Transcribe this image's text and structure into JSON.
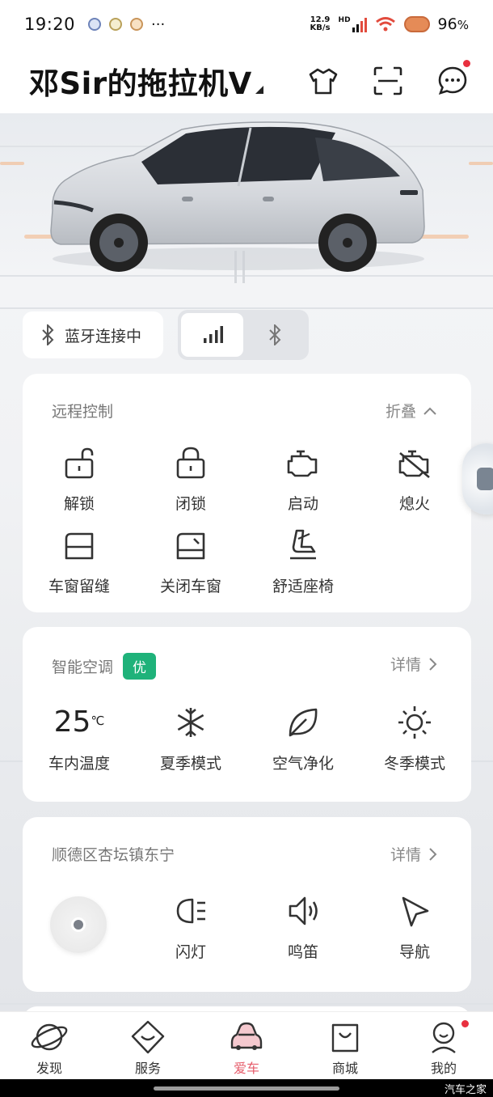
{
  "status_bar": {
    "time": "19:20",
    "dots": "···",
    "net_speed_value": "12.9",
    "net_speed_unit": "KB/s",
    "network": "HD",
    "battery": "96",
    "battery_unit": "%"
  },
  "header": {
    "title": "邓Sir的拖拉机V",
    "icons": [
      "shirt-icon",
      "scan-icon",
      "message-icon"
    ]
  },
  "connection": {
    "bluetooth_label": "蓝牙连接中",
    "modes": [
      "signal",
      "bluetooth"
    ],
    "active_mode": "signal"
  },
  "remote_control": {
    "title": "远程控制",
    "collapse_label": "折叠",
    "items": [
      {
        "label": "解锁",
        "icon": "unlock-icon"
      },
      {
        "label": "闭锁",
        "icon": "lock-icon"
      },
      {
        "label": "启动",
        "icon": "engine-start-icon"
      },
      {
        "label": "熄火",
        "icon": "engine-off-icon"
      },
      {
        "label": "车窗留缝",
        "icon": "window-vent-icon"
      },
      {
        "label": "关闭车窗",
        "icon": "window-close-icon"
      },
      {
        "label": "舒适座椅",
        "icon": "seat-icon"
      }
    ]
  },
  "climate": {
    "title": "智能空调",
    "badge": "优",
    "details_label": "详情",
    "temperature": "25",
    "temp_unit": "℃",
    "items": [
      {
        "label": "车内温度"
      },
      {
        "label": "夏季模式",
        "icon": "snowflake-icon"
      },
      {
        "label": "空气净化",
        "icon": "leaf-icon"
      },
      {
        "label": "冬季模式",
        "icon": "sun-icon"
      }
    ]
  },
  "location": {
    "title": "顺德区杏坛镇东宁",
    "details_label": "详情",
    "items": [
      {
        "label": "闪灯",
        "icon": "headlight-icon"
      },
      {
        "label": "鸣笛",
        "icon": "horn-icon"
      },
      {
        "label": "导航",
        "icon": "navigation-icon"
      }
    ]
  },
  "bottom_nav": {
    "items": [
      {
        "label": "发现",
        "icon": "planet-icon"
      },
      {
        "label": "服务",
        "icon": "service-icon"
      },
      {
        "label": "爱车",
        "icon": "car-icon"
      },
      {
        "label": "商城",
        "icon": "shop-bag-icon"
      },
      {
        "label": "我的",
        "icon": "profile-icon"
      }
    ],
    "active": "爱车"
  },
  "watermark": "汽车之家",
  "colors": {
    "accent_active": "#e65b6a",
    "badge_green": "#1fb27a",
    "notification_red": "#e8303f"
  }
}
